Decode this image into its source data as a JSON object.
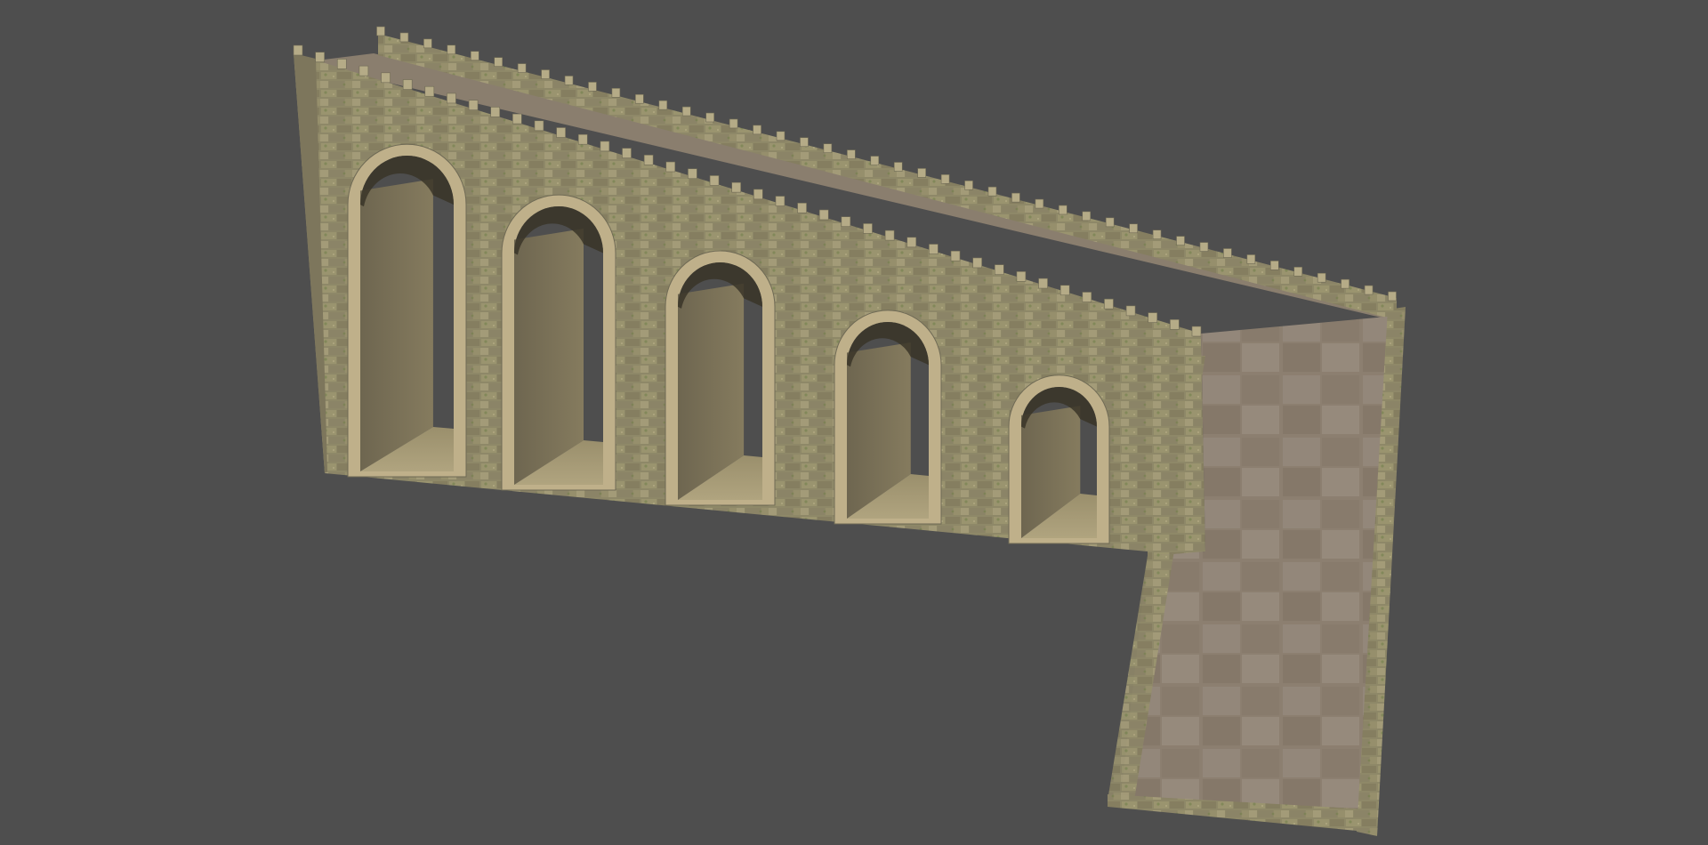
{
  "scene": {
    "background_color": "#4e4e4e",
    "stone_color": "#8e8868",
    "stone_light_color": "#b5ab87",
    "stone_dark_color": "#6f6a55",
    "trim_color": "#bfb08a",
    "arch_inner_color": "#7e7458",
    "arch_floor_color": "#a79b77",
    "walkway_color": "#8c7f70",
    "walkway_light_color": "#9e9182",
    "arch_count": 5,
    "merlon_count_front": 42,
    "merlon_count_back": 44
  }
}
